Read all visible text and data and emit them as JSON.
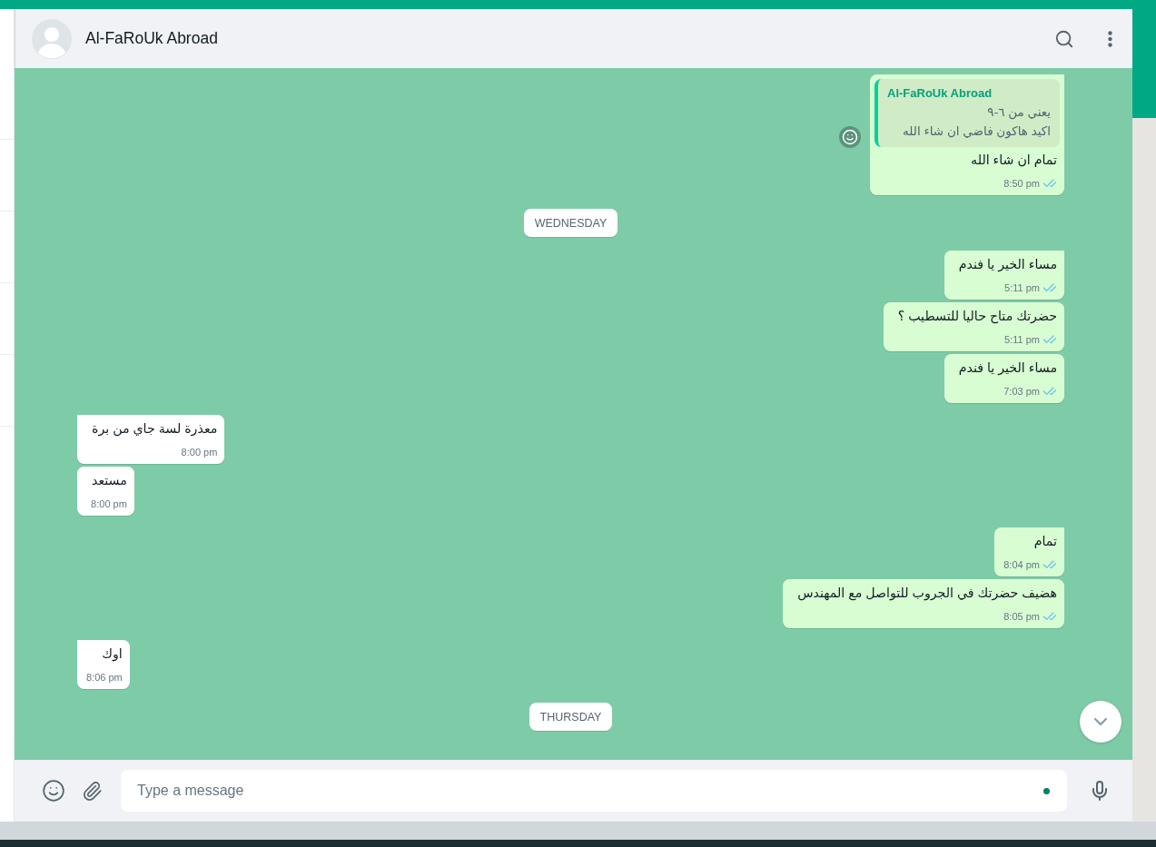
{
  "chat": {
    "name": "Al-FaRoUk Abroad"
  },
  "messages": [
    {
      "kind": "outgoing",
      "tail": true,
      "quote": {
        "author": "Al-FaRoUk Abroad",
        "lines": [
          "يعني من ٦-٩",
          "اكيد هاكون فاضي ان شاء الله"
        ]
      },
      "text": "تمام ان شاء الله",
      "time": "8:50 pm",
      "read": true
    },
    {
      "kind": "day",
      "text": "WEDNESDAY"
    },
    {
      "kind": "outgoing",
      "tail": true,
      "text": "مساء الخير يا فندم",
      "time": "5:11 pm",
      "read": true
    },
    {
      "kind": "outgoing",
      "tail": false,
      "text": "حضرتك متاح حاليا للتسطيب ؟",
      "time": "5:11 pm",
      "read": true
    },
    {
      "kind": "outgoing",
      "tail": false,
      "text": "مساء الخير يا فندم",
      "time": "7:03 pm",
      "read": true
    },
    {
      "kind": "incoming",
      "tail": true,
      "text": "معذرة لسة جاي من برة",
      "time": "8:00 pm"
    },
    {
      "kind": "incoming",
      "tail": false,
      "text": "مستعد",
      "time": "8:00 pm"
    },
    {
      "kind": "outgoing",
      "tail": true,
      "text": "تمام",
      "time": "8:04 pm",
      "read": true
    },
    {
      "kind": "outgoing",
      "tail": false,
      "text": "هضيف حضرتك في الجروب للتواصل مع المهندس",
      "time": "8:05 pm",
      "read": true
    },
    {
      "kind": "incoming",
      "tail": true,
      "text": "اوك",
      "time": "8:06 pm"
    },
    {
      "kind": "day",
      "text": "THURSDAY"
    }
  ],
  "composer": {
    "placeholder": "Type a message"
  }
}
